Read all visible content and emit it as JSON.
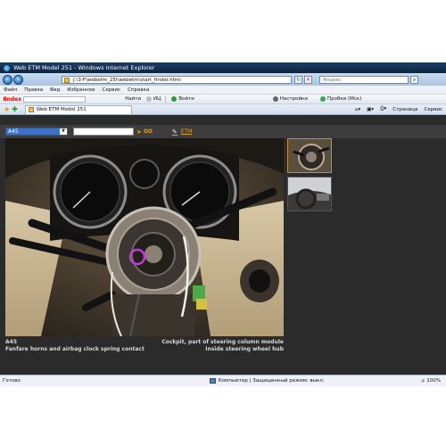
{
  "window": {
    "title": "Web ETM Model 251 - Windows Internet Explorer"
  },
  "address_bar": {
    "url": "J:\\3-F\\webetm_25l\\webetm\\start_finder.html",
    "search_placeholder": "Яндекс"
  },
  "menu": [
    "Файл",
    "Правка",
    "Вид",
    "Избранное",
    "Сервис",
    "Справка"
  ],
  "toolbar": {
    "brand": "Яndex",
    "find_label": "Найти",
    "iks_label": "ИЦ",
    "login_label": "Войти",
    "settings_label": "Настройки",
    "traffic_label": "Пробки (Мск)"
  },
  "tabbar": {
    "tab_label": "Web ETM Model 251",
    "page_menu": "Страница",
    "tools_menu": "Сервис"
  },
  "etm": {
    "selected_code": "A45",
    "code_input_value": "",
    "go_label": "GO",
    "etm_link": "ETM"
  },
  "caption": {
    "code": "A45",
    "location_line1": "Cockpit, part of steering column module",
    "description": "Fanfare horns and airbag clock spring contact",
    "location_line2": "Inside steering wheel hub"
  },
  "statusbar": {
    "status": "Готово",
    "zone": "Компьютер | Защищенный режим: выкл.",
    "zoom": "100%"
  },
  "colors": {
    "accent_orange": "#e8a020",
    "highlight_circle": "#c23bd6",
    "select_blue": "#3c73c9"
  }
}
